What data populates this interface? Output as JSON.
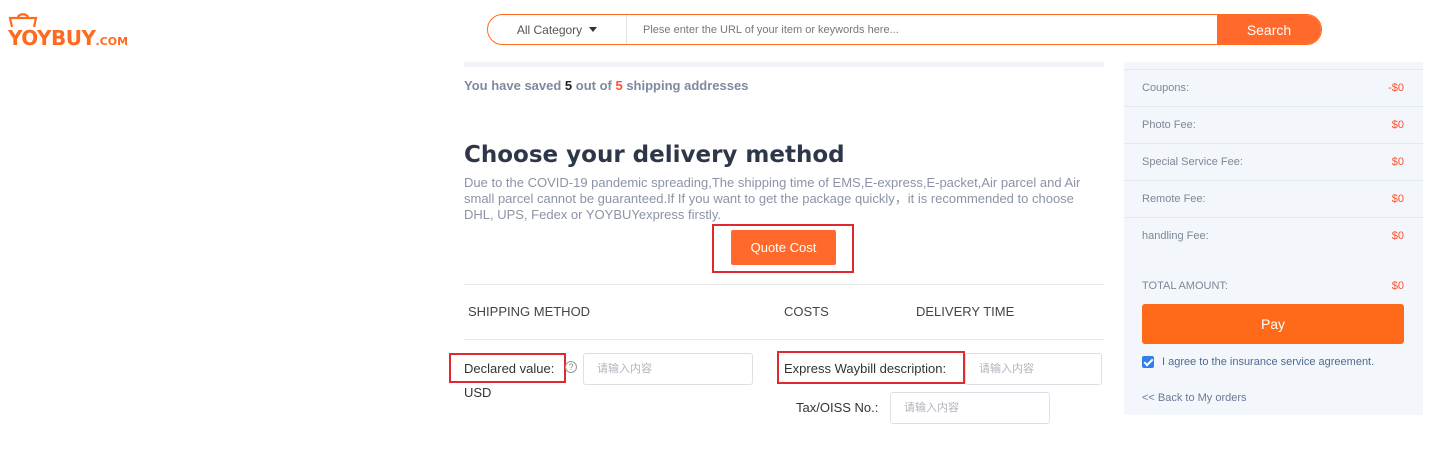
{
  "logo": {
    "text": "YOYBUY",
    "suffix": ".COM"
  },
  "search": {
    "category_label": "All Category",
    "placeholder": "Plese enter the URL of your item or keywords here...",
    "button_label": "Search"
  },
  "addresses": {
    "prefix": "You have saved ",
    "saved": "5",
    "middle": " out of ",
    "max": "5",
    "suffix": " shipping addresses"
  },
  "delivery": {
    "title": "Choose your delivery method",
    "notice": "Due to the COVID-19 pandemic spreading,The shipping time of EMS,E-express,E-packet,Air parcel and Air small parcel cannot be guaranteed.If If you want to get the package quickly，it is recommended to choose DHL, UPS, Fedex or YOYBUYexpress firstly.",
    "quote_button": "Quote Cost",
    "columns": [
      "SHIPPING METHOD",
      "COSTS",
      "DELIVERY TIME"
    ]
  },
  "form": {
    "declared_label": "Declared value:",
    "declared_unit": "USD",
    "declared_placeholder": "请输入内容",
    "waybill_label": "Express Waybill description:",
    "waybill_placeholder": "请输入内容",
    "tax_label": "Tax/OISS No.:",
    "tax_placeholder": "请输入内容",
    "help_symbol": "?"
  },
  "summary": {
    "rows": [
      {
        "label": "Coupons:",
        "value": "-$0"
      },
      {
        "label": "Photo Fee:",
        "value": "$0"
      },
      {
        "label": "Special Service Fee:",
        "value": "$0"
      },
      {
        "label": "Remote Fee:",
        "value": "$0"
      },
      {
        "label": "handling Fee:",
        "value": "$0"
      }
    ],
    "total_label": "TOTAL AMOUNT:",
    "total_value": "$0",
    "pay_button": "Pay",
    "agreement": "I agree to the insurance service agreement.",
    "agreement_checked": true,
    "back_link": "<< Back to My orders"
  },
  "colors": {
    "accent": "#ff6a2c",
    "highlight_box": "#e0282e",
    "price": "#ff4f2a",
    "checkbox": "#2f80ed"
  }
}
